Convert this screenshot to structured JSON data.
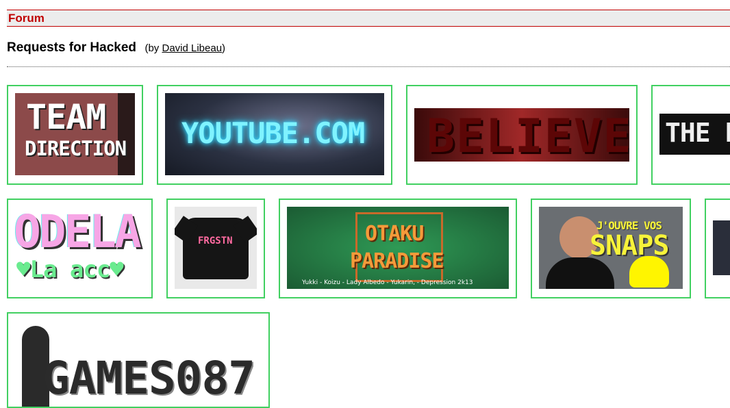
{
  "header": {
    "section": "Forum"
  },
  "page": {
    "title": "Requests for Hacked",
    "by_prefix": "(by ",
    "author": "David Libeau",
    "by_suffix": ")"
  },
  "thumbnails": {
    "team_direction": {
      "line1": "TEAM",
      "line2": "DIRECTION"
    },
    "youtube": {
      "text": "YOUTUBE.COM"
    },
    "believe": {
      "text": "BELIEVE"
    },
    "the_p": {
      "text": "THE P"
    },
    "odela": {
      "line1": "ODELA",
      "line2": "♥La acc♥"
    },
    "frgstn": {
      "text": "FRGSTN"
    },
    "otaku": {
      "line1": "OTAKU",
      "line2": "PARADISE",
      "footer": "Yukki - Koizu - Lady Albedo - Yukarin, - Depression 2k13"
    },
    "snaps": {
      "line1": "J'OUVRE VOS",
      "line2": "SNAPS"
    },
    "games": {
      "text": "GAMES087"
    }
  },
  "colors": {
    "accent": "#c00000",
    "card_border": "#40d060"
  }
}
